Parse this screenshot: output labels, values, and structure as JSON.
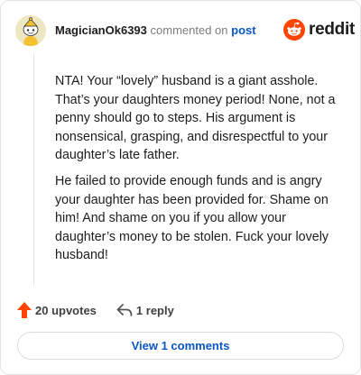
{
  "comment": {
    "username": "MagicianOk6393",
    "action_text": "commented on",
    "post_link": "post",
    "paragraphs": [
      "NTA! Your “lovely” husband is a giant asshole. That’s your daughters money period! None, not a penny should go to steps. His argument is nonsensical, grasping, and disrespectful to your daughter’s late father.",
      "He failed to provide enough funds and is angry your daughter has been provided for. Shame on him! And shame on you if you allow your daughter’s money to be stolen. Fuck your lovely husband!"
    ],
    "upvotes_label": "20 upvotes",
    "reply_label": "1 reply",
    "view_comments_label": "View 1 comments"
  },
  "brand": {
    "name": "reddit",
    "color": "#ff4500"
  },
  "colors": {
    "link": "#0a56c2",
    "upvote": "#ff4500"
  },
  "icons": {
    "avatar": "snoo-avatar-icon",
    "brand": "reddit-logo-icon",
    "upvote": "upvote-arrow-icon",
    "reply": "reply-arrow-icon"
  }
}
